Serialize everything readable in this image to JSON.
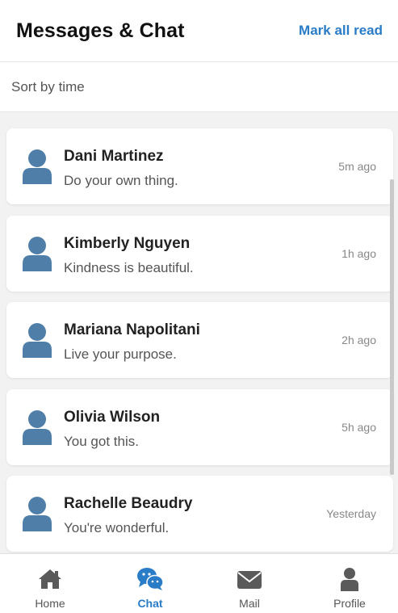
{
  "header": {
    "title": "Messages & Chat",
    "mark_all_read": "Mark all read"
  },
  "sort": {
    "label": "Sort by time"
  },
  "conversations": [
    {
      "name": "Dani Martinez",
      "message": "Do your own thing.",
      "time": "5m ago"
    },
    {
      "name": "Kimberly Nguyen",
      "message": "Kindness is beautiful.",
      "time": "1h ago"
    },
    {
      "name": "Mariana Napolitani",
      "message": "Live your purpose.",
      "time": "2h ago"
    },
    {
      "name": "Olivia Wilson",
      "message": "You got this.",
      "time": "5h ago"
    },
    {
      "name": "Rachelle Beaudry",
      "message": "You're wonderful.",
      "time": "Yesterday"
    }
  ],
  "tabs": [
    {
      "label": "Home",
      "icon": "home-icon",
      "active": false
    },
    {
      "label": "Chat",
      "icon": "chat-icon",
      "active": true
    },
    {
      "label": "Mail",
      "icon": "mail-icon",
      "active": false
    },
    {
      "label": "Profile",
      "icon": "profile-icon",
      "active": false
    }
  ],
  "colors": {
    "accent": "#2a7cc7",
    "avatar": "#4f7fa8",
    "inactive_icon": "#5a5a5a"
  }
}
